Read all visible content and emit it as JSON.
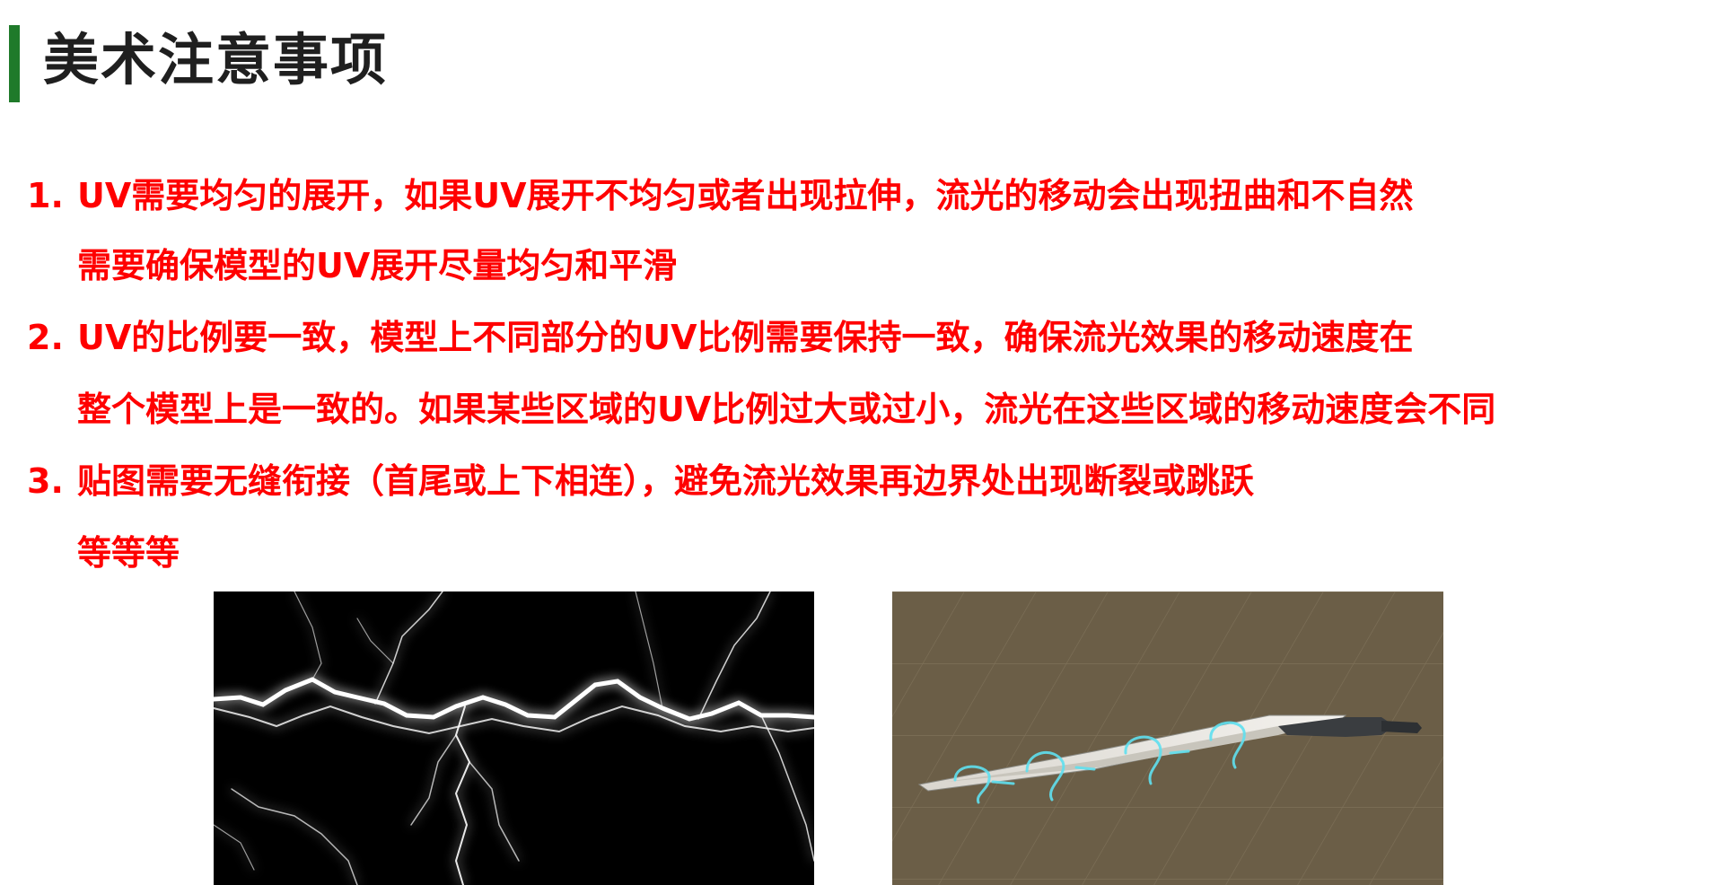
{
  "header": {
    "title": "美术注意事项",
    "accent_color": "#1f7a2a"
  },
  "notes": {
    "color": "#ff0000",
    "items": [
      {
        "number": "1.",
        "lines": [
          "UV需要均匀的展开，如果UV展开不均匀或者出现拉伸，流光的移动会出现扭曲和不自然",
          "需要确保模型的UV展开尽量均匀和平滑"
        ]
      },
      {
        "number": "2.",
        "lines": [
          "UV的比例要一致，模型上不同部分的UV比例需要保持一致，确保流光效果的移动速度在",
          "整个模型上是一致的。如果某些区域的UV比例过大或过小，流光在这些区域的移动速度会不同"
        ]
      },
      {
        "number": "3.",
        "lines": [
          "贴图需要无缝衔接（首尾或上下相连），避免流光效果再边界处出现断裂或跳跃",
          "等等等"
        ]
      }
    ]
  },
  "images": {
    "left": {
      "subject": "lightning-texture",
      "background": "#000000"
    },
    "right": {
      "subject": "sword-flow-light-model",
      "background": "#6b5e47",
      "effect_color": "#5fe0f0"
    }
  }
}
